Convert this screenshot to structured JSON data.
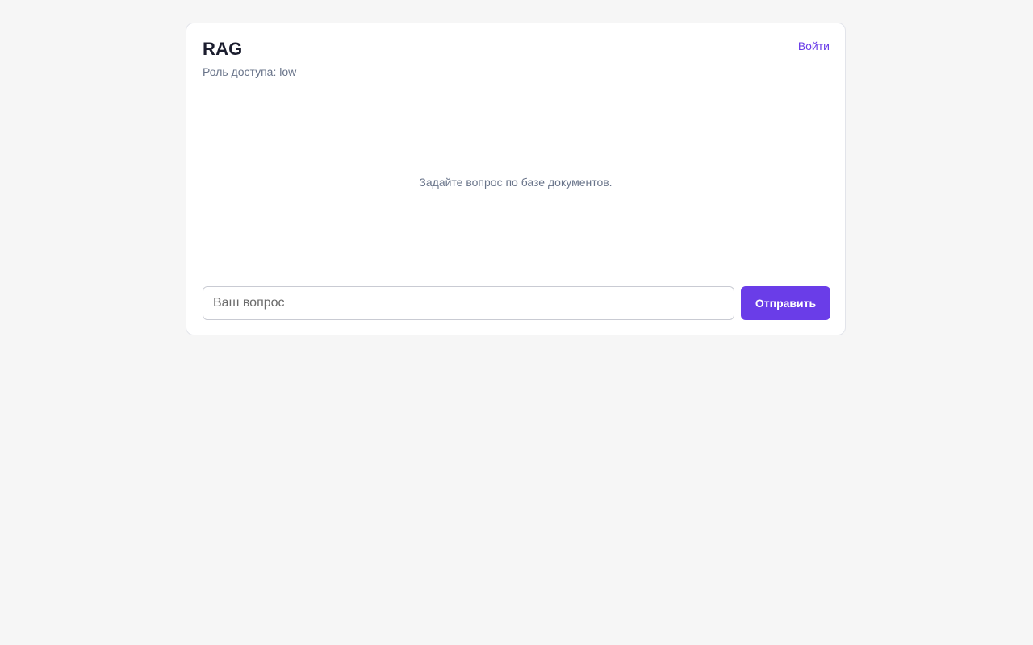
{
  "app": {
    "title": "RAG",
    "role_text": "Роль доступа: low",
    "login_label": "Войти"
  },
  "chat": {
    "empty_message": "Задайте вопрос по базе документов."
  },
  "composer": {
    "placeholder": "Ваш вопрос",
    "value": "",
    "send_label": "Отправить"
  },
  "colors": {
    "accent": "#6a3de8",
    "background": "#f6f6f6",
    "card": "#ffffff",
    "muted_text": "#69748a"
  }
}
